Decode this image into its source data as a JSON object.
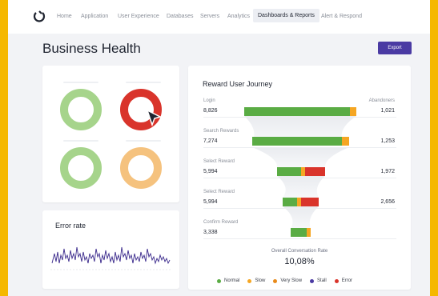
{
  "nav": {
    "items": [
      "Home",
      "Application",
      "User Experience",
      "Databases",
      "Servers",
      "Analytics",
      "Dashboards & Reports",
      "Alert & Respond"
    ],
    "active_index": 6
  },
  "page": {
    "title": "Business Health",
    "export_label": "Export"
  },
  "health_rings": [
    {
      "status": "normal",
      "color": "#a6d48b"
    },
    {
      "status": "error",
      "color": "#d9342b"
    },
    {
      "status": "normal",
      "color": "#a6d48b"
    },
    {
      "status": "slow",
      "color": "#f5c27e"
    }
  ],
  "error_rate": {
    "title": "Error rate"
  },
  "journey": {
    "title": "Reward User Journey",
    "abandoners_label": "Abandoners",
    "steps": [
      {
        "label": "Login",
        "value": "8,826",
        "abandoners": "1,021"
      },
      {
        "label": "Search Rewards",
        "value": "7,274",
        "abandoners": "1,253"
      },
      {
        "label": "Select Reward",
        "value": "5,994",
        "abandoners": "1,972"
      },
      {
        "label": "Select Reward",
        "value": "5,994",
        "abandoners": "2,656"
      },
      {
        "label": "Confirm Reward",
        "value": "3,338",
        "abandoners": ""
      }
    ],
    "conversion_label": "Overall Conversation Rate",
    "conversion_value": "10,08%"
  },
  "legend": [
    {
      "label": "Normal",
      "color": "#5aac44"
    },
    {
      "label": "Slow",
      "color": "#f5a623"
    },
    {
      "label": "Very Slow",
      "color": "#e88a1a"
    },
    {
      "label": "Stall",
      "color": "#4a3aa3"
    },
    {
      "label": "Error",
      "color": "#d9342b"
    }
  ],
  "colors": {
    "accent": "#4a3aa3",
    "background": "#f5b800"
  }
}
